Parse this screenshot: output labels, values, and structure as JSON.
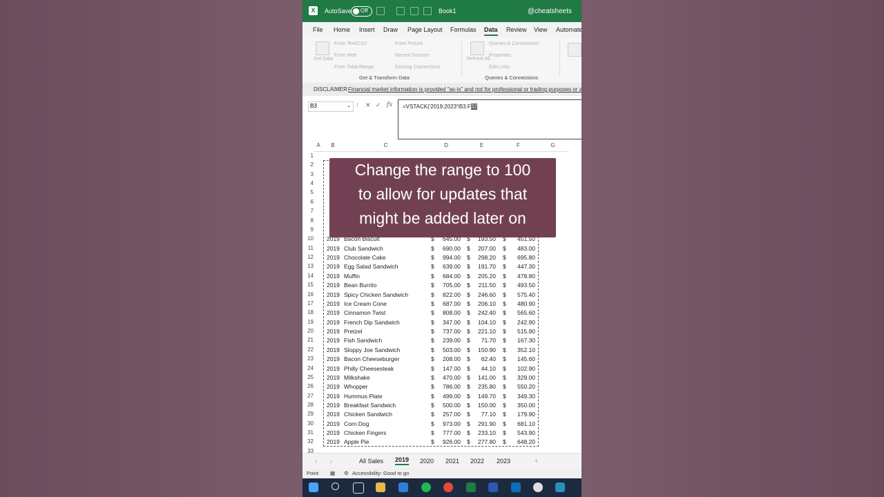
{
  "window": {
    "title": "Book1",
    "autosave_label": "AutoSave",
    "autosave_state": "Off",
    "user": "@cheatsheets",
    "app_icon": "excel-icon"
  },
  "menu": [
    "File",
    "Home",
    "Insert",
    "Draw",
    "Page Layout",
    "Formulas",
    "Data",
    "Review",
    "View",
    "Automate"
  ],
  "menu_active": "Data",
  "ribbon": {
    "get_data": "Get Data",
    "from_text": "From Text/CSV",
    "from_web": "From Web",
    "from_table": "From Table/Range",
    "from_picture": "From Picture",
    "recent_sources": "Recent Sources",
    "existing_connections": "Existing Connections",
    "refresh_all": "Refresh All",
    "queries_connections": "Queries & Connections",
    "properties": "Properties",
    "edit_links": "Edit Links",
    "group1": "Get & Transform Data",
    "group2": "Queries & Connections"
  },
  "disclaimer": {
    "label": "DISCLAIMER",
    "text": "Financial market information is provided \"as-is\" and not for professional or trading purposes or a"
  },
  "formula_bar": {
    "name_box": "B3",
    "fx": "fx",
    "formula_prefix": "=VSTACK('2019:2023'!B3:F",
    "formula_selected": "32"
  },
  "columns": [
    "A",
    "B",
    "C",
    "D",
    "E",
    "F",
    "G"
  ],
  "rows": [
    {
      "n": "1"
    },
    {
      "n": "2"
    },
    {
      "n": "3"
    },
    {
      "n": "4"
    },
    {
      "n": "5"
    },
    {
      "n": "6"
    },
    {
      "n": "7"
    },
    {
      "n": "8"
    },
    {
      "n": "9"
    },
    {
      "n": "10",
      "y": "2019",
      "item": "Bacon Biscuit",
      "d": "645.00",
      "e": "193.50",
      "f": "451.50"
    },
    {
      "n": "11",
      "y": "2019",
      "item": "Club Sandwich",
      "d": "690.00",
      "e": "207.00",
      "f": "483.00"
    },
    {
      "n": "12",
      "y": "2019",
      "item": "Chocolate Cake",
      "d": "994.00",
      "e": "298.20",
      "f": "695.80"
    },
    {
      "n": "13",
      "y": "2019",
      "item": "Egg Salad Sandwich",
      "d": "639.00",
      "e": "191.70",
      "f": "447.30"
    },
    {
      "n": "14",
      "y": "2019",
      "item": "Muffin",
      "d": "684.00",
      "e": "205.20",
      "f": "478.80"
    },
    {
      "n": "15",
      "y": "2019",
      "item": "Bean Burrito",
      "d": "705.00",
      "e": "211.50",
      "f": "493.50"
    },
    {
      "n": "16",
      "y": "2019",
      "item": "Spicy Chicken Sandwich",
      "d": "822.00",
      "e": "246.60",
      "f": "575.40"
    },
    {
      "n": "17",
      "y": "2019",
      "item": "Ice Cream Cone",
      "d": "687.00",
      "e": "206.10",
      "f": "480.90"
    },
    {
      "n": "18",
      "y": "2019",
      "item": "Cinnamon Twist",
      "d": "808.00",
      "e": "242.40",
      "f": "565.60"
    },
    {
      "n": "19",
      "y": "2019",
      "item": "French Dip Sandwich",
      "d": "347.00",
      "e": "104.10",
      "f": "242.90"
    },
    {
      "n": "20",
      "y": "2019",
      "item": "Pretzel",
      "d": "737.00",
      "e": "221.10",
      "f": "515.90"
    },
    {
      "n": "21",
      "y": "2019",
      "item": "Fish Sandwich",
      "d": "239.00",
      "e": "71.70",
      "f": "167.30"
    },
    {
      "n": "22",
      "y": "2019",
      "item": "Sloppy Joe Sandwich",
      "d": "503.00",
      "e": "150.90",
      "f": "352.10"
    },
    {
      "n": "23",
      "y": "2019",
      "item": "Bacon Cheeseburger",
      "d": "208.00",
      "e": "62.40",
      "f": "145.60"
    },
    {
      "n": "24",
      "y": "2019",
      "item": "Philly Cheesesteak",
      "d": "147.00",
      "e": "44.10",
      "f": "102.90"
    },
    {
      "n": "25",
      "y": "2019",
      "item": "Milkshake",
      "d": "470.00",
      "e": "141.00",
      "f": "329.00"
    },
    {
      "n": "26",
      "y": "2019",
      "item": "Whopper",
      "d": "786.00",
      "e": "235.80",
      "f": "550.20"
    },
    {
      "n": "27",
      "y": "2019",
      "item": "Hummus Plate",
      "d": "499.00",
      "e": "149.70",
      "f": "349.30"
    },
    {
      "n": "28",
      "y": "2019",
      "item": "Breakfast Sandwich",
      "d": "500.00",
      "e": "150.00",
      "f": "350.00"
    },
    {
      "n": "29",
      "y": "2019",
      "item": "Chicken Sandwich",
      "d": "257.00",
      "e": "77.10",
      "f": "179.90"
    },
    {
      "n": "30",
      "y": "2019",
      "item": "Corn Dog",
      "d": "973.00",
      "e": "291.90",
      "f": "681.10"
    },
    {
      "n": "31",
      "y": "2019",
      "item": "Chicken Fingers",
      "d": "777.00",
      "e": "233.10",
      "f": "543.90"
    },
    {
      "n": "32",
      "y": "2019",
      "item": "Apple Pie",
      "d": "926.00",
      "e": "277.80",
      "f": "648.20"
    },
    {
      "n": "33"
    }
  ],
  "currency": "$",
  "overlay_lines": [
    "Change the range to 100",
    "to allow for updates that",
    "might be added later on"
  ],
  "sheet_tabs": [
    "All Sales",
    "2019",
    "2020",
    "2021",
    "2022",
    "2023"
  ],
  "active_tab": "2019",
  "status": {
    "mode": "Point",
    "accessibility": "Accessibility: Good to go"
  }
}
